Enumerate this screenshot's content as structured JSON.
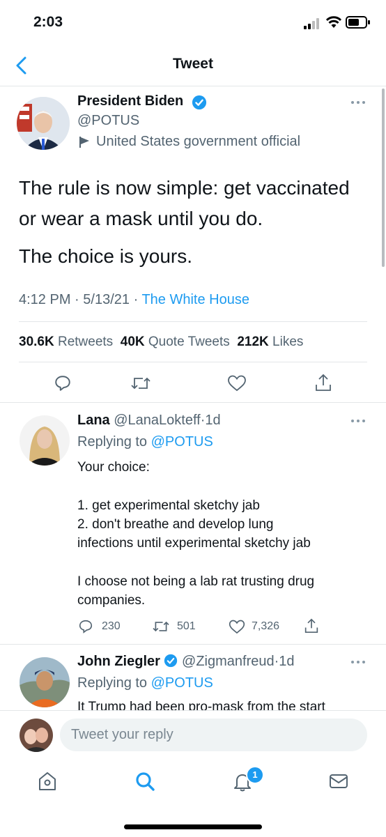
{
  "status_bar": {
    "time": "2:03"
  },
  "nav": {
    "title": "Tweet"
  },
  "main_tweet": {
    "name": "President Biden",
    "handle": "@POTUS",
    "label": "United States government official",
    "text_line1": "The rule is now simple: get vaccinated",
    "text_line2": "or wear a mask until you do.",
    "text_line3": "The choice is yours.",
    "time": "4:12 PM",
    "date": "5/13/21",
    "source": "The White House",
    "retweets_count": "30.6K",
    "retweets_label": "Retweets",
    "quotes_count": "40K",
    "quotes_label": "Quote Tweets",
    "likes_count": "212K",
    "likes_label": "Likes"
  },
  "reply1": {
    "name": "Lana",
    "handle": "@LanaLokteff",
    "age": "1d",
    "replying_prefix": "Replying to",
    "replying_to": "@POTUS",
    "line1": "Your choice:",
    "line2": "1. get experimental sketchy jab",
    "line3": "2. don't breathe and develop lung",
    "line4": "infections until experimental sketchy jab",
    "line5": "I choose not being a lab rat trusting drug",
    "line6": "companies.",
    "replies": "230",
    "retweets": "501",
    "likes": "7,326"
  },
  "reply2": {
    "name": "John Ziegler",
    "handle": "@Zigmanfreud",
    "age": "1d",
    "replying_prefix": "Replying to",
    "replying_to": "@POTUS",
    "line1": "It Trump had been pro-mask from the start"
  },
  "composer": {
    "placeholder": "Tweet your reply"
  },
  "tabbar": {
    "notification_badge": "1"
  },
  "colors": {
    "accent": "#1d9bf0",
    "verified": "#1d9bf0",
    "text": "#0f1419",
    "muted": "#536471"
  }
}
